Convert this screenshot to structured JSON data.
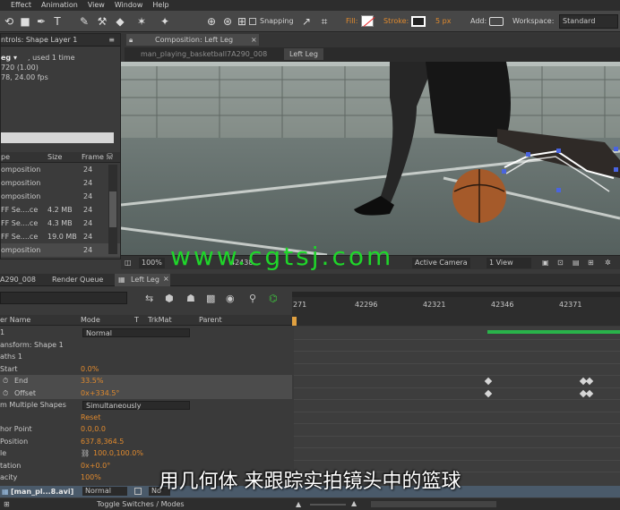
{
  "menu": [
    "Effect",
    "Animation",
    "View",
    "Window",
    "Help"
  ],
  "toolbar": {
    "snapping_label": "Snapping",
    "fill_label": "Fill:",
    "stroke_label": "Stroke:",
    "stroke_width": "5 px",
    "add_label": "Add:",
    "workspace_label": "Workspace:",
    "workspace_value": "Standard"
  },
  "effect_controls": {
    "tab": "ntrols: Shape Layer 1",
    "item_name": "eg ▾",
    "used": ", used 1 time",
    "size_line": "720 (1.00)",
    "fps_line": "78, 24.00 fps"
  },
  "project": {
    "columns": [
      "pe",
      "Size",
      "Frame ..."
    ],
    "rows": [
      {
        "type": "omposition",
        "size": "",
        "frame": "24"
      },
      {
        "type": "omposition",
        "size": "",
        "frame": "24"
      },
      {
        "type": "omposition",
        "size": "",
        "frame": "24"
      },
      {
        "type": "FF Se....ce",
        "size": "4.2 MB",
        "frame": "24"
      },
      {
        "type": "FF Se....ce",
        "size": "4.3 MB",
        "frame": "24"
      },
      {
        "type": "FF Se....ce",
        "size": "19.0 MB",
        "frame": "24"
      },
      {
        "type": "omposition",
        "size": "",
        "frame": "24"
      }
    ]
  },
  "composition": {
    "tab": "Composition: Left Leg",
    "breadcrumb_1": "man_playing_basketball7A290_008",
    "breadcrumb_2": "Left Leg",
    "zoom": "100%",
    "timecode": "42438",
    "camera": "Active Camera",
    "view": "1 View"
  },
  "timeline": {
    "tabs": [
      "A290_008",
      "Render Queue",
      "Left Leg"
    ],
    "columns": [
      "er Name",
      "Mode",
      "T",
      "TrkMat",
      "Parent"
    ],
    "ruler": [
      "271",
      "42296",
      "42321",
      "42346",
      "42371"
    ],
    "rows": [
      {
        "name": "1",
        "value": "Normal",
        "indent": 0
      },
      {
        "name": "ansform: Shape 1",
        "value": "",
        "indent": 0
      },
      {
        "name": "aths 1",
        "value": "",
        "indent": 0
      },
      {
        "name": "Start",
        "value": "0.0%",
        "indent": 0
      },
      {
        "name": "End",
        "value": "33.5%",
        "indent": 1
      },
      {
        "name": "Offset",
        "value": "0x+334.5°",
        "indent": 1
      },
      {
        "name": "m Multiple Shapes",
        "value": "Simultaneously",
        "indent": 0
      },
      {
        "name": "",
        "value": "Reset",
        "indent": 0
      },
      {
        "name": "hor Point",
        "value": "0.0,0.0",
        "indent": 0
      },
      {
        "name": "Position",
        "value": "637.8,364.5",
        "indent": 0
      },
      {
        "name": "le",
        "value": "100.0,100.0%",
        "indent": 0
      },
      {
        "name": "tation",
        "value": "0x+0.0°",
        "indent": 0
      },
      {
        "name": "acity",
        "value": "100%",
        "indent": 0
      }
    ],
    "bottom_layer": "[man_pl...8.avi]",
    "bottom_mode": "Normal",
    "bottom_none": "No",
    "toggle_label": "Toggle Switches / Modes"
  },
  "watermark": "www.cgtsj.com",
  "subtitle": "用几何体 来跟踪实拍镜头中的篮球",
  "colors": {
    "accent": "#e08a2e",
    "keyframe_bar": "#29b34a"
  }
}
